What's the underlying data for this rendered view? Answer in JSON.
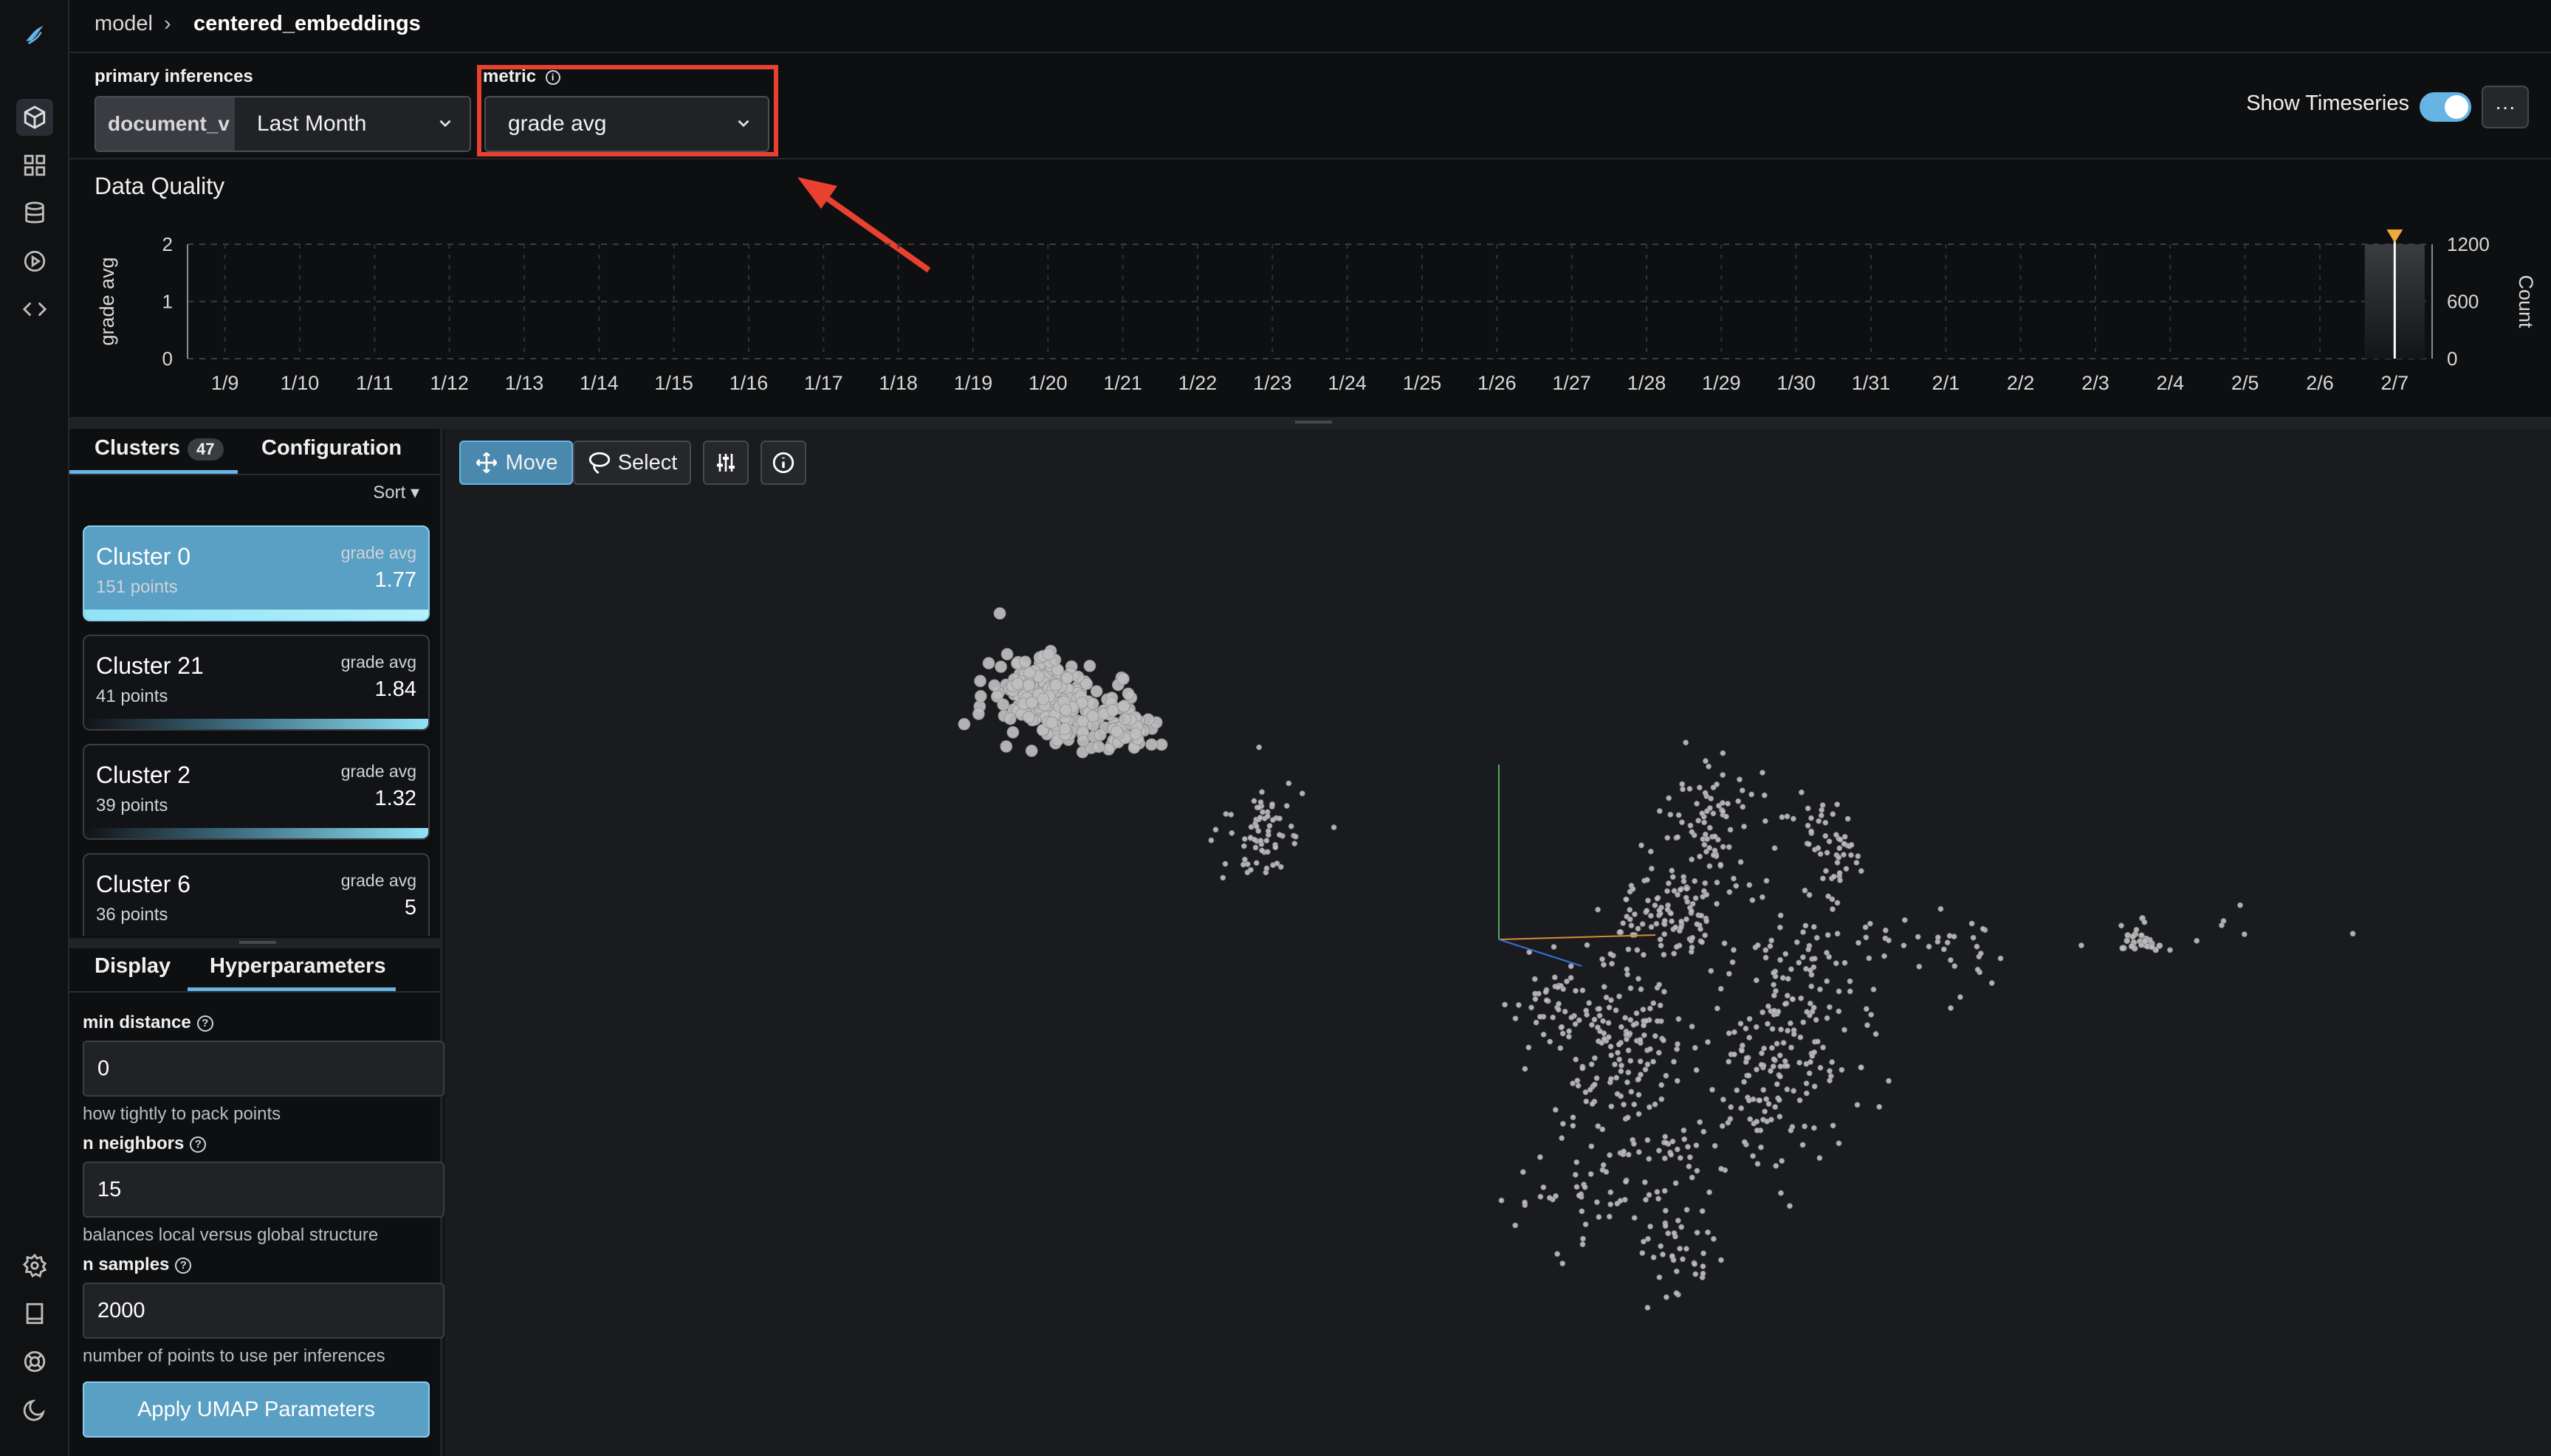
{
  "breadcrumb": {
    "model": "model",
    "separator": "›",
    "current": "centered_embeddings"
  },
  "controls": {
    "primary_label": "primary inferences",
    "primary_dataset": "document_v",
    "primary_range": "Last Month",
    "metric_label": "metric",
    "metric_value": "grade avg",
    "show_timeseries_label": "Show Timeseries",
    "more_label": "···"
  },
  "data_quality": {
    "title": "Data Quality",
    "chart_data": {
      "type": "line",
      "ylabel": "grade avg",
      "y2label": "Count",
      "ylim": [
        0,
        2
      ],
      "y2lim": [
        0,
        1200
      ],
      "yticks": [
        "0",
        "1",
        "2"
      ],
      "y2ticks": [
        "0",
        "600",
        "1200"
      ],
      "categories": [
        "1/9",
        "1/10",
        "1/11",
        "1/12",
        "1/13",
        "1/14",
        "1/15",
        "1/16",
        "1/17",
        "1/18",
        "1/19",
        "1/20",
        "1/21",
        "1/22",
        "1/23",
        "1/24",
        "1/25",
        "1/26",
        "1/27",
        "1/28",
        "1/29",
        "1/30",
        "1/31",
        "2/1",
        "2/2",
        "2/3",
        "2/4",
        "2/5",
        "2/6",
        "2/7"
      ],
      "count_bar": {
        "x": "2/7",
        "value": 1200
      },
      "selected": "2/7",
      "grid": true
    }
  },
  "left_tabs": {
    "clusters": "Clusters",
    "clusters_count": "47",
    "configuration": "Configuration"
  },
  "sort_label": "Sort ▾",
  "clusters": [
    {
      "name": "Cluster 0",
      "points": "151 points",
      "metric": "grade avg",
      "value": "1.77",
      "selected": true
    },
    {
      "name": "Cluster 21",
      "points": "41 points",
      "metric": "grade avg",
      "value": "1.84",
      "selected": false
    },
    {
      "name": "Cluster 2",
      "points": "39 points",
      "metric": "grade avg",
      "value": "1.32",
      "selected": false
    },
    {
      "name": "Cluster 6",
      "points": "36 points",
      "metric": "grade avg",
      "value": "5",
      "selected": false
    }
  ],
  "lower_tabs": {
    "display": "Display",
    "hyperparameters": "Hyperparameters"
  },
  "hyper": {
    "min_distance": {
      "label": "min distance",
      "value": "0",
      "help": "how tightly to pack points"
    },
    "n_neighbors": {
      "label": "n neighbors",
      "value": "15",
      "help": "balances local versus global structure"
    },
    "n_samples": {
      "label": "n samples",
      "value": "2000",
      "help": "number of points to use per inferences"
    },
    "apply": "Apply UMAP Parameters"
  },
  "toolbar": {
    "move": "Move",
    "select": "Select"
  },
  "colors": {
    "accent": "#66b4e3",
    "annotation": "#e8412f",
    "marker": "#f2a93b",
    "point": "#bfbfbf"
  }
}
